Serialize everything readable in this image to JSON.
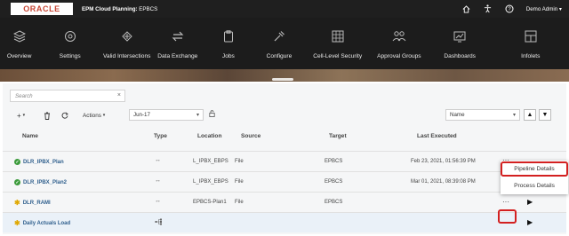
{
  "header": {
    "logo_text": "ORACLE",
    "app_prefix": "EPM Cloud Planning:",
    "app_name": "EPBCS",
    "user": "Demo Admin",
    "icons": [
      "home-icon",
      "accessibility-icon",
      "help-icon"
    ]
  },
  "nav": {
    "items": [
      {
        "label": "Overview",
        "icon": "overview-icon"
      },
      {
        "label": "Settings",
        "icon": "settings-icon"
      },
      {
        "label": "Valid Intersections",
        "icon": "valid-intersections-icon"
      },
      {
        "label": "Data Exchange",
        "icon": "data-exchange-icon"
      },
      {
        "label": "Jobs",
        "icon": "jobs-icon"
      },
      {
        "label": "Configure",
        "icon": "configure-icon"
      },
      {
        "label": "Cell-Level Security",
        "icon": "cell-level-security-icon"
      },
      {
        "label": "Approval Groups",
        "icon": "approval-groups-icon"
      },
      {
        "label": "Dashboards",
        "icon": "dashboards-icon"
      },
      {
        "label": "Infolets",
        "icon": "infolets-icon"
      }
    ]
  },
  "search": {
    "placeholder": "Search"
  },
  "toolbar": {
    "actions_label": "Actions",
    "period_value": "Jun-17",
    "sort_value": "Name"
  },
  "table": {
    "columns": [
      "Name",
      "Type",
      "Location",
      "Source",
      "Target",
      "Last Executed"
    ],
    "rows": [
      {
        "name": "DLR_IPBX_Plan",
        "status": "success",
        "location": "L_IPBX_EBPS",
        "source": "File",
        "target": "EPBCS",
        "last_executed": "Feb 23, 2021, 01:56:39 PM"
      },
      {
        "name": "DLR_IPBX_Plan2",
        "status": "success",
        "location": "L_IPBX_EBPS",
        "source": "File",
        "target": "EPBCS",
        "last_executed": "Mar 01, 2021, 08:39:08 PM"
      },
      {
        "name": "DLR_RAMI",
        "status": "new",
        "location": "EPBCS-Plan1",
        "source": "File",
        "target": "EPBCS",
        "last_executed": ""
      },
      {
        "name": "Daily Actuals Load",
        "status": "new",
        "location": "",
        "source": "",
        "target": "",
        "last_executed": ""
      }
    ]
  },
  "menu": {
    "items": [
      "Pipeline Details",
      "Process Details"
    ]
  },
  "colors": {
    "oracle_red": "#c74634",
    "highlight_red": "#d32020",
    "link_blue": "#2f5f8d",
    "success_green": "#3c9b3c",
    "new_star": "#e0a800"
  }
}
